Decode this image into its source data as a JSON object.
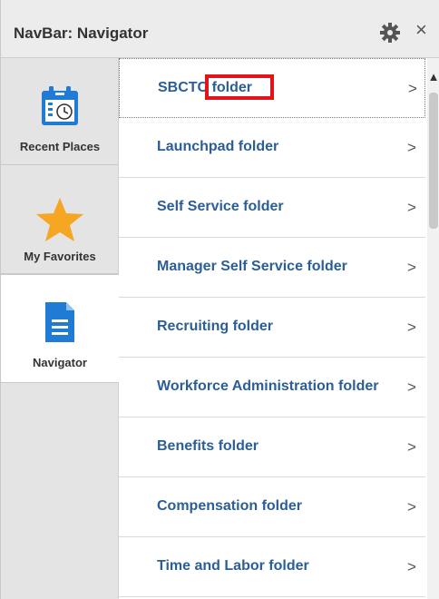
{
  "header": {
    "title": "NavBar: Navigator",
    "gear_icon": "gear-icon",
    "close_label": "×"
  },
  "rail": {
    "items": [
      {
        "label": "Recent Places",
        "icon": "calendar-clock-icon"
      },
      {
        "label": "My Favorites",
        "icon": "star-icon"
      },
      {
        "label": "Navigator",
        "icon": "document-icon"
      }
    ]
  },
  "list": {
    "items": [
      {
        "label_prefix": "SBCTC",
        "label_suffix": "folder",
        "chevron": ">"
      },
      {
        "label": "Launchpad folder",
        "chevron": ">"
      },
      {
        "label": "Self Service folder",
        "chevron": ">"
      },
      {
        "label": "Manager Self Service folder",
        "chevron": ">"
      },
      {
        "label": "Recruiting folder",
        "chevron": ">"
      },
      {
        "label": "Workforce Administration folder",
        "chevron": ">"
      },
      {
        "label": "Benefits folder",
        "chevron": ">"
      },
      {
        "label": "Compensation folder",
        "chevron": ">"
      },
      {
        "label": "Time and Labor folder",
        "chevron": ">"
      }
    ]
  },
  "colors": {
    "link": "#2b5e96",
    "highlight": "#e1141b",
    "star": "#f5a623",
    "icon_blue": "#1f7bd3"
  }
}
